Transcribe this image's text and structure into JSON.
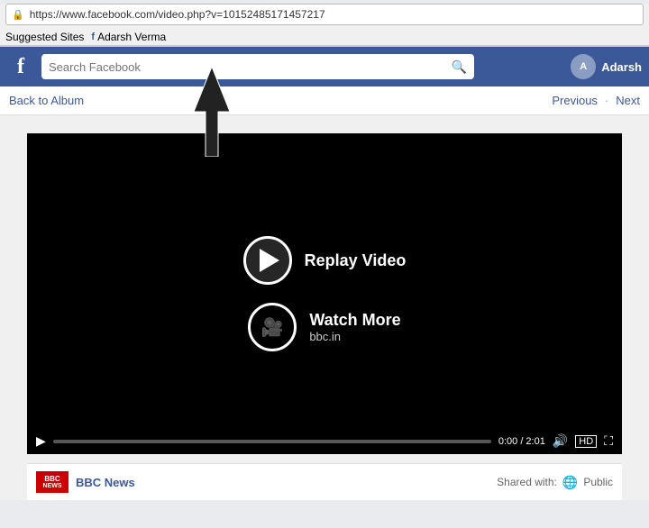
{
  "browser": {
    "url": "https://www.facebook.com/video.php?v=10152485171457217",
    "lock_symbol": "🔒",
    "bookmarks": [
      {
        "label": "Suggested Sites"
      },
      {
        "label": "Adarsh Verma",
        "has_fb_icon": true
      }
    ]
  },
  "header": {
    "fb_logo": "f",
    "search_placeholder": "Search Facebook",
    "search_icon": "🔍",
    "username": "Adarsh"
  },
  "navigation": {
    "back_label": "Back to Album",
    "previous_label": "Previous",
    "next_label": "Next"
  },
  "video": {
    "replay_label": "Replay Video",
    "watch_more_label": "Watch More",
    "watch_more_sublabel": "bbc.in",
    "time_current": "0:00",
    "time_total": "2:01",
    "time_display": "0:00 / 2:01",
    "hd_label": "HD"
  },
  "video_info": {
    "bbc_line1": "BBC",
    "bbc_line2": "NEWS",
    "source_name": "BBC News",
    "shared_label": "Shared with:",
    "visibility": "Public"
  },
  "arrow": {
    "label": "↑"
  }
}
